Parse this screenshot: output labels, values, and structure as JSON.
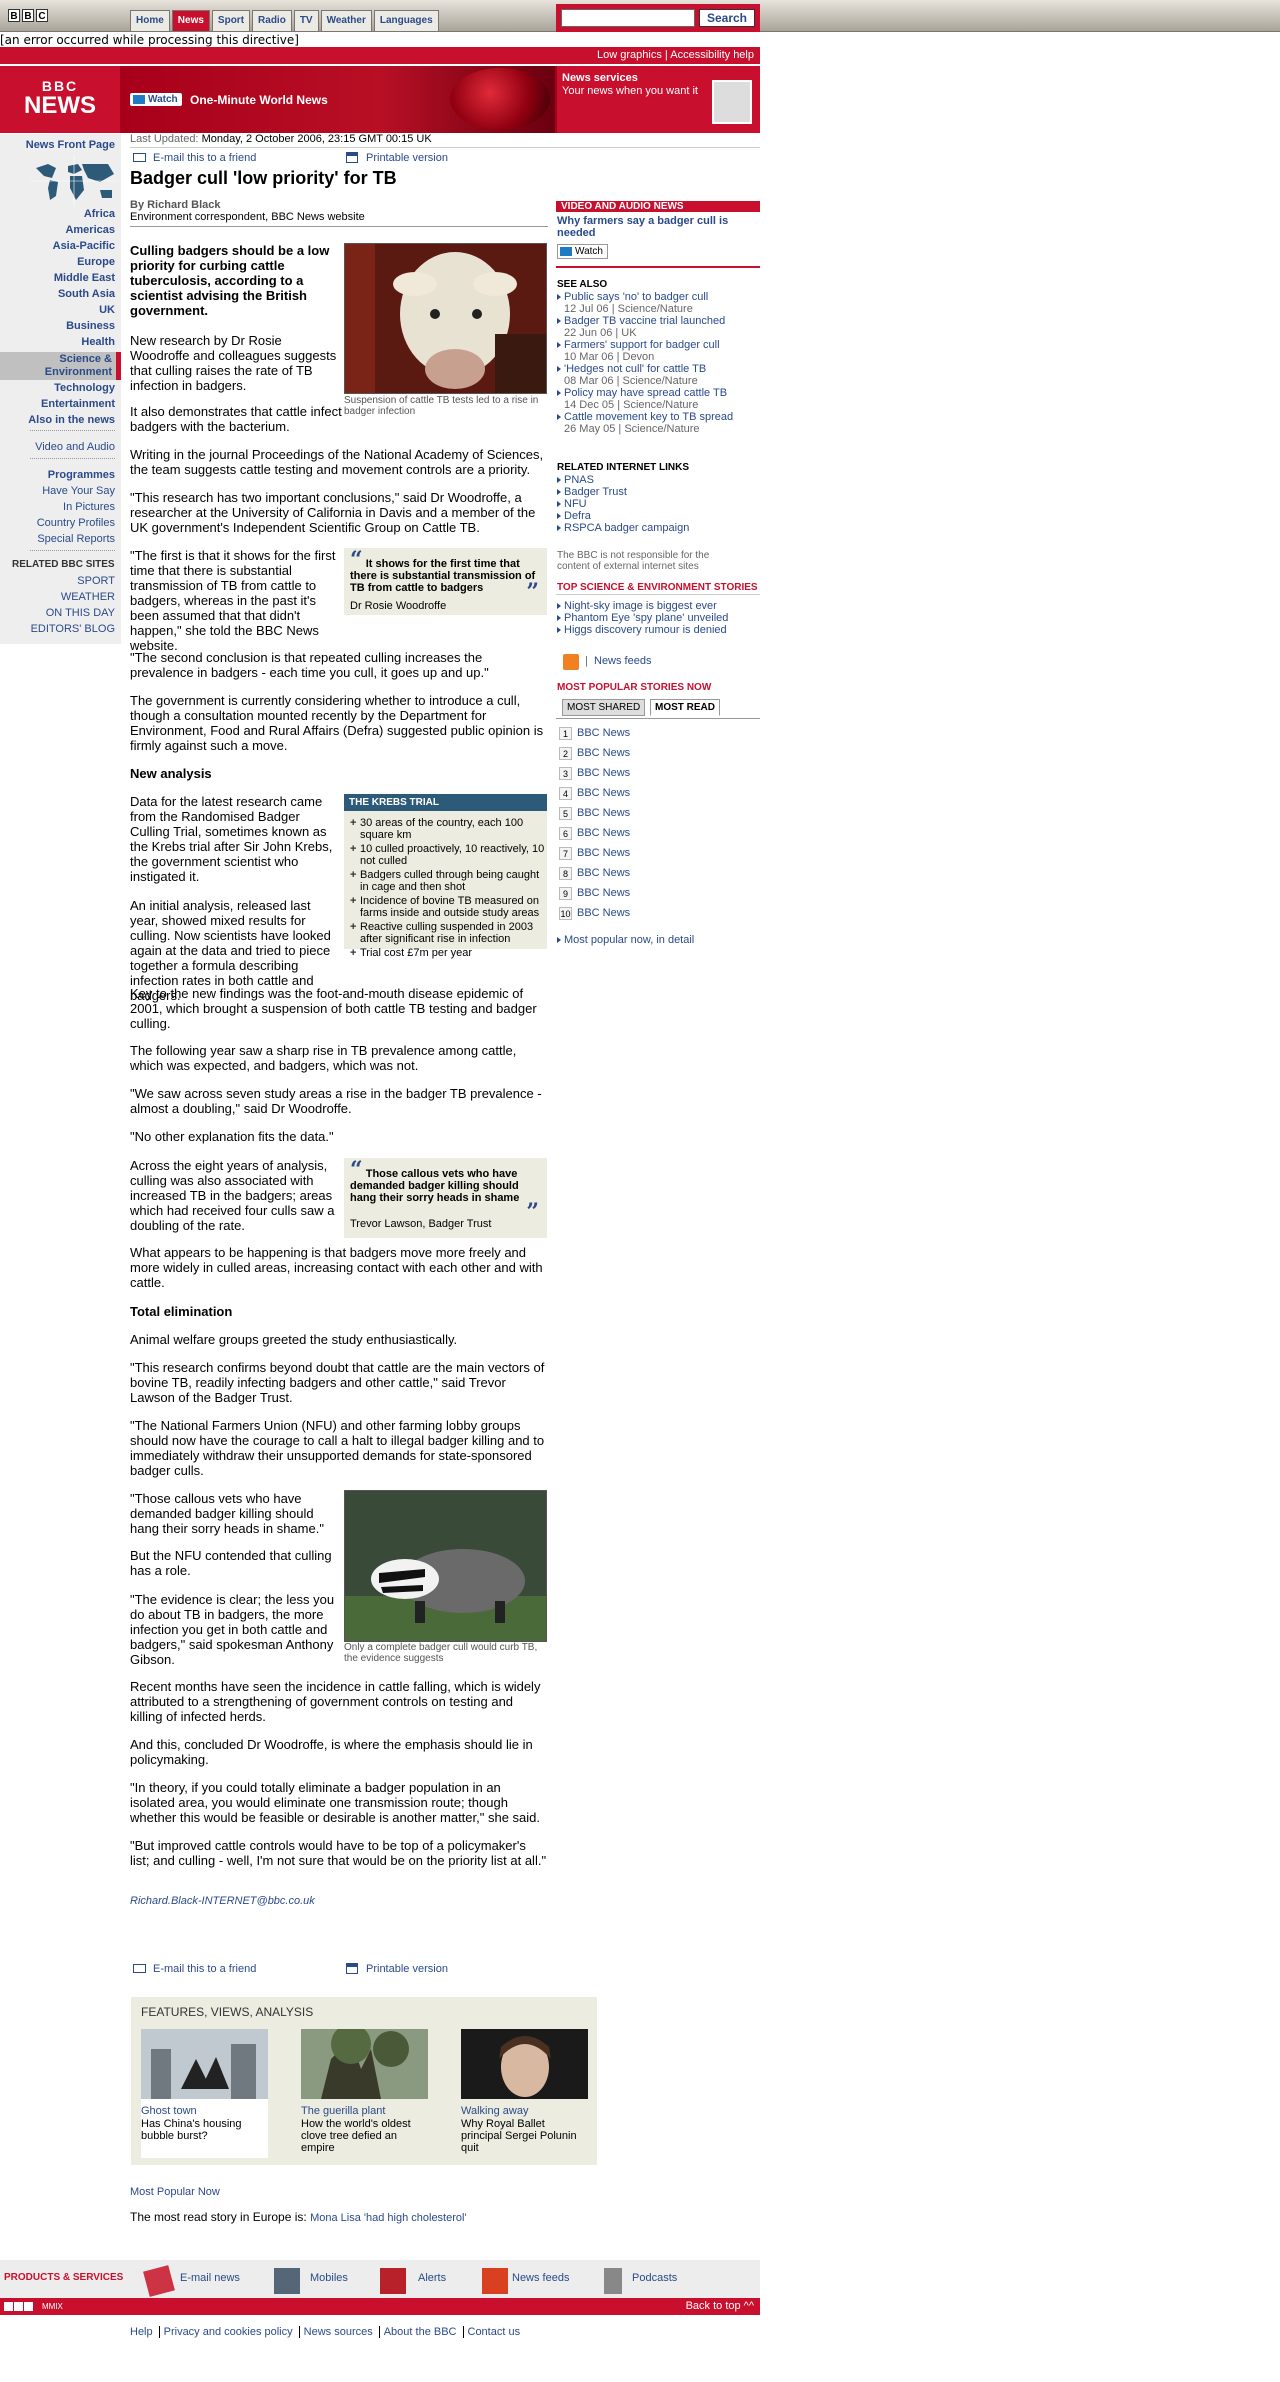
{
  "nav": {
    "bbc_letters": [
      "B",
      "B",
      "C"
    ],
    "tabs": [
      "Home",
      "News",
      "Sport",
      "Radio",
      "TV",
      "Weather",
      "Languages"
    ],
    "search_button": "Search",
    "search_value": ""
  },
  "error_message": "[an error occurred while processing this directive]",
  "top_links": {
    "low_graphics": "Low graphics",
    "separator": "|",
    "accessibility": "Accessibility help"
  },
  "banner": {
    "logo_top": "BBC",
    "logo_bottom": "NEWS",
    "watch_label": "Watch",
    "one_minute": "One-Minute World News",
    "services_title": "News services",
    "services_sub": "Your news when you want it"
  },
  "left_nav": {
    "front_page": "News Front Page",
    "items": [
      "Africa",
      "Americas",
      "Asia-Pacific",
      "Europe",
      "Middle East",
      "South Asia",
      "UK",
      "Business",
      "Health",
      "Science & Environment",
      "Technology",
      "Entertainment",
      "Also in the news"
    ],
    "video_audio": "Video and Audio",
    "programmes": "Programmes",
    "extra": [
      "Have Your Say",
      "In Pictures",
      "Country Profiles",
      "Special Reports"
    ],
    "related_title": "RELATED BBC SITES",
    "related": [
      "SPORT",
      "WEATHER",
      "ON THIS DAY",
      "EDITORS' BLOG"
    ]
  },
  "article": {
    "last_updated_label": "Last Updated:",
    "last_updated": "Monday, 2 October 2006, 23:15 GMT 00:15 UK",
    "email_friend": "E-mail this to a friend",
    "printable": "Printable version",
    "headline": "Badger cull 'low priority' for TB",
    "byline": "By Richard Black",
    "byline_role": "Environment correspondent, BBC News website",
    "intro": "Culling badgers should be a low priority for curbing cattle tuberculosis, according to a scientist advising the British government.",
    "p1": "New research by Dr Rosie Woodroffe and colleagues suggests that culling raises the rate of TB infection in badgers.",
    "p2": "It also demonstrates that cattle infect badgers with the bacterium.",
    "p3": "Writing in the journal Proceedings of the National Academy of Sciences, the team suggests cattle testing and movement controls are a priority.",
    "p4": "\"This research has two important conclusions,\" said Dr Woodroffe, a researcher at the University of California in Davis and a member of the UK government's Independent Scientific Group on Cattle TB.",
    "p5": "\"The first is that it shows for the first time that there is substantial transmission of TB from cattle to badgers, whereas in the past it's been assumed that that didn't happen,\" she told the BBC News website.",
    "p6": "\"The second conclusion is that repeated culling increases the prevalence in badgers - each time you cull, it goes up and up.\"",
    "p7": "The government is currently considering whether to introduce a cull, though a consultation mounted recently by the Department for Environment, Food and Rural Affairs (Defra) suggested public opinion is firmly against such a move.",
    "h_new": "New analysis",
    "p8": "Data for the latest research came from the Randomised Badger Culling Trial, sometimes known as the Krebs trial after Sir John Krebs, the government scientist who instigated it.",
    "p9": "An initial analysis, released last year, showed mixed results for culling. Now scientists have looked again at the data and tried to piece together a formula describing infection rates in both cattle and badgers.",
    "p10": "Key to the new findings was the foot-and-mouth disease epidemic of 2001, which brought a suspension of both cattle TB testing and badger culling.",
    "p11": "The following year saw a sharp rise in TB prevalence among cattle, which was expected, and badgers, which was not.",
    "p12": "\"We saw across seven study areas a rise in the badger TB prevalence - almost a doubling,\" said Dr Woodroffe.",
    "p13": "\"No other explanation fits the data.\"",
    "p14": "Across the eight years of analysis, culling was also associated with increased TB in the badgers; areas which had received four culls saw a doubling of the rate.",
    "p15": "What appears to be happening is that badgers move more freely and more widely in culled areas, increasing contact with each other and with cattle.",
    "h_total": "Total elimination",
    "p16": "Animal welfare groups greeted the study enthusiastically.",
    "p17": "\"This research confirms beyond doubt that cattle are the main vectors of bovine TB, readily infecting badgers and other cattle,\" said Trevor Lawson of the Badger Trust.",
    "p18": "\"The National Farmers Union (NFU) and other farming lobby groups should now have the courage to call a halt to illegal badger killing and to immediately withdraw their unsupported demands for state-sponsored badger culls.",
    "p19": "\"Those callous vets who have demanded badger killing should hang their sorry heads in shame.\"",
    "p20": "But the NFU contended that culling has a role.",
    "p21": "\"The evidence is clear; the less you do about TB in badgers, the more infection you get in both cattle and badgers,\" said spokesman Anthony Gibson.",
    "p22": "Recent months have seen the incidence in cattle falling, which is widely attributed to a strengthening of government controls on testing and killing of infected herds.",
    "p23": "And this, concluded Dr Woodroffe, is where the emphasis should lie in policymaking.",
    "p24": "\"In theory, if you could totally eliminate a badger population in an isolated area, you would eliminate one transmission route; though whether this would be feasible or desirable is another matter,\" she said.",
    "p25": "\"But improved cattle controls would have to be top of a policymaker's list; and culling - well, I'm not sure that would be on the priority list at all.\"",
    "email_author": "Richard.Black-INTERNET@bbc.co.uk",
    "caption_cow": "Suspension of cattle TB tests led to a rise in badger infection",
    "caption_badger": "Only a complete badger cull would curb TB, the evidence suggests",
    "quote1": "It shows for the first time that there is substantial transmission of TB from cattle to badgers",
    "quote1_by": "Dr Rosie Woodroffe",
    "quote2": "Those callous vets who have demanded badger killing should hang their sorry heads in shame",
    "quote2_by": "Trevor Lawson, Badger Trust",
    "krebs_title": "THE KREBS TRIAL",
    "krebs_items": [
      "30 areas of the country, each 100 square km",
      "10 culled proactively, 10 reactively, 10 not culled",
      "Badgers culled through being caught in cage and then shot",
      "Incidence of bovine TB measured on farms inside and outside study areas",
      "Reactive culling suspended in 2003 after significant rise in infection",
      "Trial cost £7m per year"
    ]
  },
  "right": {
    "video_title": "VIDEO AND AUDIO NEWS",
    "video_link": "Why farmers say a badger cull is needed",
    "watch": "Watch",
    "see_also_title": "SEE ALSO",
    "see_also": [
      {
        "title": "Public says 'no' to badger cull",
        "meta": "12 Jul 06 |  Science/Nature"
      },
      {
        "title": "Badger TB vaccine trial launched",
        "meta": "22 Jun 06 |  UK"
      },
      {
        "title": "Farmers' support for badger cull",
        "meta": "10 Mar 06 |  Devon"
      },
      {
        "title": "'Hedges not cull' for cattle TB",
        "meta": "08 Mar 06 |  Science/Nature"
      },
      {
        "title": "Policy may have spread cattle TB",
        "meta": "14 Dec 05 |  Science/Nature"
      },
      {
        "title": "Cattle movement key to TB spread",
        "meta": "26 May 05 |  Science/Nature"
      }
    ],
    "related_title": "RELATED INTERNET LINKS",
    "related": [
      "PNAS",
      "Badger Trust",
      "NFU",
      "Defra",
      "RSPCA badger campaign"
    ],
    "disclaimer": "The BBC is not responsible for the content of external internet sites",
    "top_title": "TOP SCIENCE & ENVIRONMENT STORIES",
    "top": [
      "Night-sky image is biggest ever",
      "Phantom Eye 'spy plane' unveiled",
      "Higgs discovery rumour is denied"
    ],
    "feeds": "News feeds",
    "feeds_sep": "|",
    "popular_title": "MOST POPULAR STORIES NOW",
    "tab_shared": "MOST SHARED",
    "tab_read": "MOST READ",
    "popular": [
      "BBC News",
      "BBC News",
      "BBC News",
      "BBC News",
      "BBC News",
      "BBC News",
      "BBC News",
      "BBC News",
      "BBC News",
      "BBC News"
    ],
    "popular_more": "Most popular now, in detail"
  },
  "features": {
    "title": "FEATURES, VIEWS, ANALYSIS",
    "items": [
      {
        "title": "Ghost town",
        "desc": "Has China's housing bubble burst?"
      },
      {
        "title": "The guerilla plant",
        "desc": "How the world's oldest clove tree defied an empire"
      },
      {
        "title": "Walking away",
        "desc": "Why Royal Ballet principal Sergei Polunin quit"
      }
    ]
  },
  "most_popular_now": "Most Popular Now",
  "europe": {
    "label": "The most read story in Europe is:",
    "link": "Mona Lisa 'had high cholesterol'"
  },
  "products": {
    "title": "PRODUCTS & SERVICES",
    "items": [
      "E-mail news",
      "Mobiles",
      "Alerts",
      "News feeds",
      "Podcasts"
    ]
  },
  "footer": {
    "mmix": "MMIX",
    "back_to_top": "Back to top ^^",
    "links": [
      "Help",
      "Privacy and cookies policy",
      "News sources",
      "About the BBC",
      "Contact us"
    ]
  },
  "colors": {
    "brand_red": "#c8102e",
    "link_blue": "#2a4a8a",
    "box_bg": "#ecece0"
  }
}
